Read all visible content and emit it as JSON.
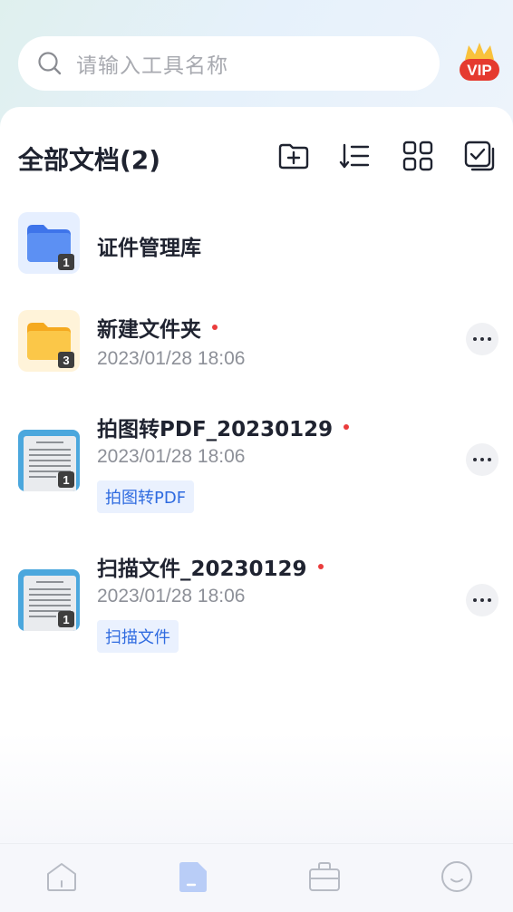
{
  "search": {
    "placeholder": "请输入工具名称"
  },
  "vip": {
    "label": "VIP"
  },
  "header": {
    "title": "全部文档(2)"
  },
  "toolbar": {
    "icons": [
      "folder-add-icon",
      "sort-icon",
      "grid-view-icon",
      "multi-select-icon"
    ]
  },
  "items": [
    {
      "name": "证件管理库",
      "type": "folder",
      "color": "#4f86f0",
      "count": "1",
      "has_dot": false,
      "date": "",
      "tag": ""
    },
    {
      "name": "新建文件夹",
      "type": "folder",
      "color": "#f7b731",
      "count": "3",
      "has_dot": true,
      "date": "2023/01/28  18:06",
      "tag": ""
    },
    {
      "name": "拍图转PDF_20230129",
      "type": "document",
      "count": "1",
      "has_dot": true,
      "date": "2023/01/28  18:06",
      "tag": "拍图转PDF"
    },
    {
      "name": "扫描文件_20230129",
      "type": "document",
      "count": "1",
      "has_dot": true,
      "date": "2023/01/28  18:06",
      "tag": "扫描文件"
    }
  ],
  "bottom_nav": {
    "items": [
      "home-icon",
      "documents-icon",
      "toolbox-icon",
      "profile-icon"
    ],
    "active_index": 1,
    "active_color": "#b9cdf7"
  },
  "colors": {
    "accent": "#2f6be0",
    "unread_dot": "#ea3c3c",
    "text_primary": "#1f2330",
    "text_secondary": "#8d9098"
  }
}
